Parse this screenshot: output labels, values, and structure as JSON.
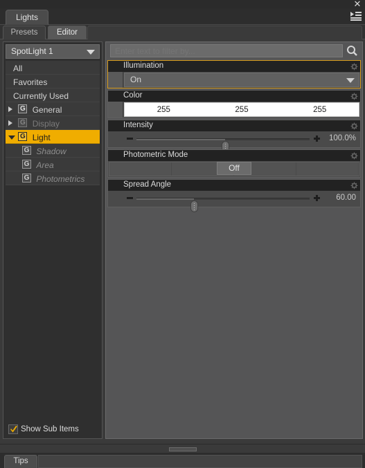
{
  "window": {
    "close_label": "✕",
    "menu_icon": "hamburger-menu-icon"
  },
  "tabs_primary": [
    {
      "label": "Lights",
      "active": true
    }
  ],
  "tabs_secondary": [
    {
      "label": "Presets",
      "active": false
    },
    {
      "label": "Editor",
      "active": true
    }
  ],
  "sidebar": {
    "selector": {
      "value": "SpotLight 1",
      "icon": "chevron-down-icon"
    },
    "tree": [
      {
        "label": "All",
        "type": "plain"
      },
      {
        "label": "Favorites",
        "type": "plain"
      },
      {
        "label": "Currently Used",
        "type": "plain"
      },
      {
        "label": "General",
        "type": "node",
        "expanded": false,
        "badge": "G"
      },
      {
        "label": "Display",
        "type": "node",
        "expanded": false,
        "badge": "G",
        "dim": true
      },
      {
        "label": "Light",
        "type": "node",
        "expanded": true,
        "badge": "G",
        "selected": true
      },
      {
        "label": "Shadow",
        "type": "sub",
        "badge": "G"
      },
      {
        "label": "Area",
        "type": "sub",
        "badge": "G"
      },
      {
        "label": "Photometrics",
        "type": "sub",
        "badge": "G"
      }
    ],
    "show_sub_items": {
      "label": "Show Sub Items",
      "checked": true
    }
  },
  "search": {
    "placeholder": "Enter text to filter by...",
    "value": "",
    "icon": "search-icon"
  },
  "properties": [
    {
      "title": "Illumination",
      "kind": "dropdown",
      "value": "On",
      "highlighted": true,
      "gear": "gear-icon"
    },
    {
      "title": "Color",
      "kind": "color",
      "channels": [
        "255",
        "255",
        "255"
      ],
      "gear": "gear-icon"
    },
    {
      "title": "Intensity",
      "kind": "slider",
      "value": "100.0%",
      "percent": 51,
      "gear": "gear-icon"
    },
    {
      "title": "Photometric Mode",
      "kind": "segmented",
      "value": "Off",
      "gear": "gear-icon"
    },
    {
      "title": "Spread Angle",
      "kind": "slider",
      "value": "60.00",
      "percent": 33,
      "gear": "gear-icon"
    }
  ],
  "footer": {
    "tips_label": "Tips"
  },
  "colors": {
    "accent": "#f0ad00",
    "highlight_border": "#d79b1b",
    "panel_bg": "#555556",
    "group_bg": "#4a4a4a",
    "header_bg": "#222222",
    "sidebar_bg": "#2f2f2f"
  }
}
